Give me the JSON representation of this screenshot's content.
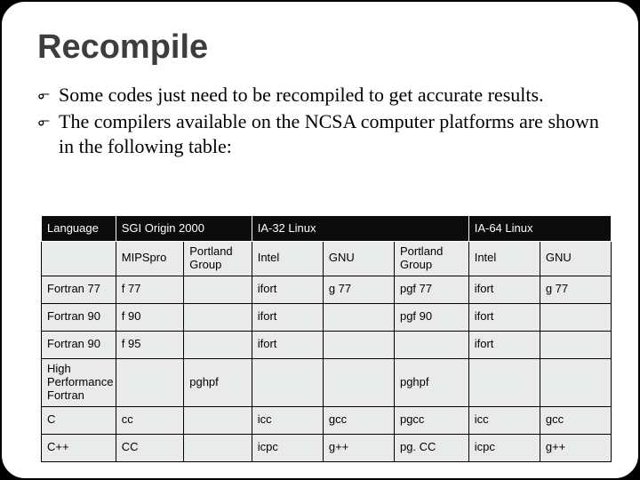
{
  "title": "Recompile",
  "bullets": [
    "Some codes just need to be recompiled to get accurate results.",
    "The compilers available on the NCSA computer platforms are shown in the following table:"
  ],
  "bullet_marker": "൳",
  "table": {
    "header": {
      "col0": "Language",
      "col1_span": "SGI Origin 2000",
      "col3_span": "IA-32 Linux",
      "col6_span": "IA-64 Linux"
    },
    "subheader": {
      "c0": "",
      "c1": "MIPSpro",
      "c2": "Portland Group",
      "c3": "Intel",
      "c4": "GNU",
      "c5": "Portland Group",
      "c6": "Intel",
      "c7": "GNU"
    },
    "rows": [
      {
        "c0": "Fortran 77",
        "c1": "f 77",
        "c2": "",
        "c3": "ifort",
        "c4": "g 77",
        "c5": "pgf 77",
        "c6": "ifort",
        "c7": "g 77"
      },
      {
        "c0": "Fortran 90",
        "c1": "f 90",
        "c2": "",
        "c3": "ifort",
        "c4": "",
        "c5": "pgf 90",
        "c6": "ifort",
        "c7": ""
      },
      {
        "c0": "Fortran 90",
        "c1": "f 95",
        "c2": "",
        "c3": "ifort",
        "c4": "",
        "c5": "",
        "c6": "ifort",
        "c7": ""
      },
      {
        "c0": "High Performance Fortran",
        "c1": "",
        "c2": "pghpf",
        "c3": "",
        "c4": "",
        "c5": "pghpf",
        "c6": "",
        "c7": "",
        "tall": true
      },
      {
        "c0": "C",
        "c1": "cc",
        "c2": "",
        "c3": "icc",
        "c4": "gcc",
        "c5": "pgcc",
        "c6": "icc",
        "c7": "gcc"
      },
      {
        "c0": "C++",
        "c1": "CC",
        "c2": "",
        "c3": "icpc",
        "c4": "g++",
        "c5": "pg. CC",
        "c6": "icpc",
        "c7": "g++"
      }
    ]
  }
}
